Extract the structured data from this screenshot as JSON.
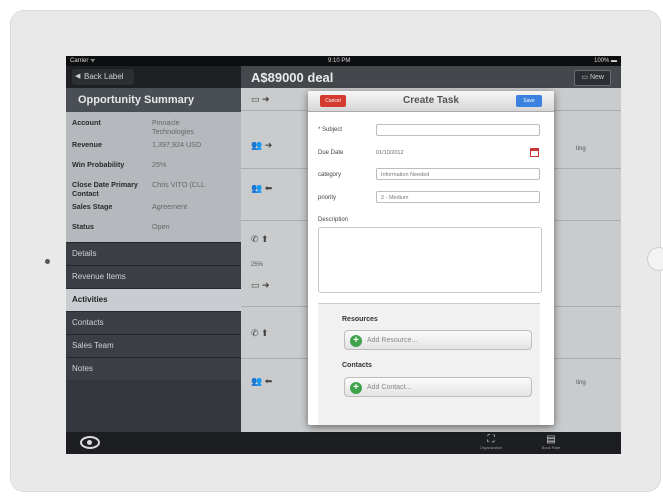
{
  "status": {
    "carrier": "Carrier ᯤ",
    "time": "9:10 PM",
    "battery": "100% ▬"
  },
  "left": {
    "back_label": "Back Label",
    "summary_title": "Opportunity Summary",
    "fields": [
      {
        "label": "Account",
        "value": "Pinnacle Technologies"
      },
      {
        "label": "Revenue",
        "value": "1,397,924 USD"
      },
      {
        "label": "Win Probability",
        "value": "25%"
      },
      {
        "label": "Close Date Primary Contact",
        "value": "Chris VITO (CLL"
      },
      {
        "label": "Sales Stage",
        "value": "Agreement"
      },
      {
        "label": "Status",
        "value": "Open"
      }
    ],
    "nav": [
      "Details",
      "Revenue Items",
      "Activities",
      "Contacts",
      "Sales Team",
      "Notes"
    ],
    "active_nav": "Activities"
  },
  "right": {
    "title": "A$89000 deal",
    "new_label": "New",
    "row_snippets": [
      "ting",
      "25%",
      "ting"
    ]
  },
  "modal": {
    "cancel_label": "Cancel",
    "save_label": "Save",
    "title": "Create Task",
    "subject_label": "* Subject",
    "subject_value": "",
    "due_date_label": "Due Date",
    "due_date_value": "01/10/2012",
    "category_label": "category",
    "category_value": "Information Needed",
    "priority_label": "priority",
    "priority_value": "2 - Medium",
    "description_label": "Description",
    "resources_title": "Resources",
    "add_resource": "Add Resource...",
    "contacts_title": "Contacts",
    "add_contact": "Add Contact..."
  },
  "tabbar": {
    "tab1": "Organization",
    "tab2": "Book Rate"
  },
  "colors": {
    "cancel": "#d43a2f",
    "save": "#3b82e0",
    "add": "#3fa34d"
  }
}
